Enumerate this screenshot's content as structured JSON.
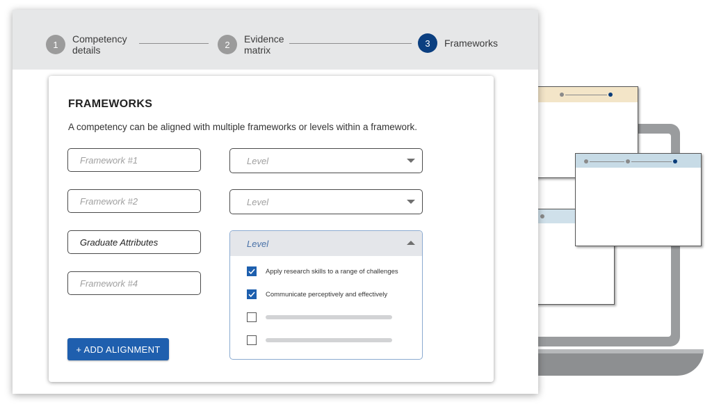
{
  "stepper": {
    "steps": [
      {
        "number": "1",
        "label_line1": "Competency",
        "label_line2": "details",
        "active": false
      },
      {
        "number": "2",
        "label_line1": "Evidence",
        "label_line2": "matrix",
        "active": false
      },
      {
        "number": "3",
        "label_line1": "Frameworks",
        "label_line2": "",
        "active": true
      }
    ]
  },
  "card": {
    "title": "FRAMEWORKS",
    "description": "A competency can be aligned with multiple frameworks or levels within a framework."
  },
  "frameworks": [
    {
      "placeholder": "Framework #1",
      "value": ""
    },
    {
      "placeholder": "Framework #2",
      "value": ""
    },
    {
      "placeholder": "",
      "value": "Graduate Attributes"
    },
    {
      "placeholder": "Framework #4",
      "value": ""
    }
  ],
  "levels": [
    {
      "placeholder": "Level"
    },
    {
      "placeholder": "Level"
    },
    {
      "placeholder": "Level"
    }
  ],
  "level_options": [
    {
      "label": "Apply research skills to a range of challenges",
      "checked": true
    },
    {
      "label": "Communicate perceptively and effectively",
      "checked": true
    },
    {
      "label": "",
      "checked": false
    },
    {
      "label": "",
      "checked": false
    }
  ],
  "add_button": {
    "label": "+ ADD ALIGNMENT"
  },
  "colors": {
    "accent": "#1f5fae",
    "active_step": "#0b3f80",
    "header_bg": "#e6e7e8"
  }
}
